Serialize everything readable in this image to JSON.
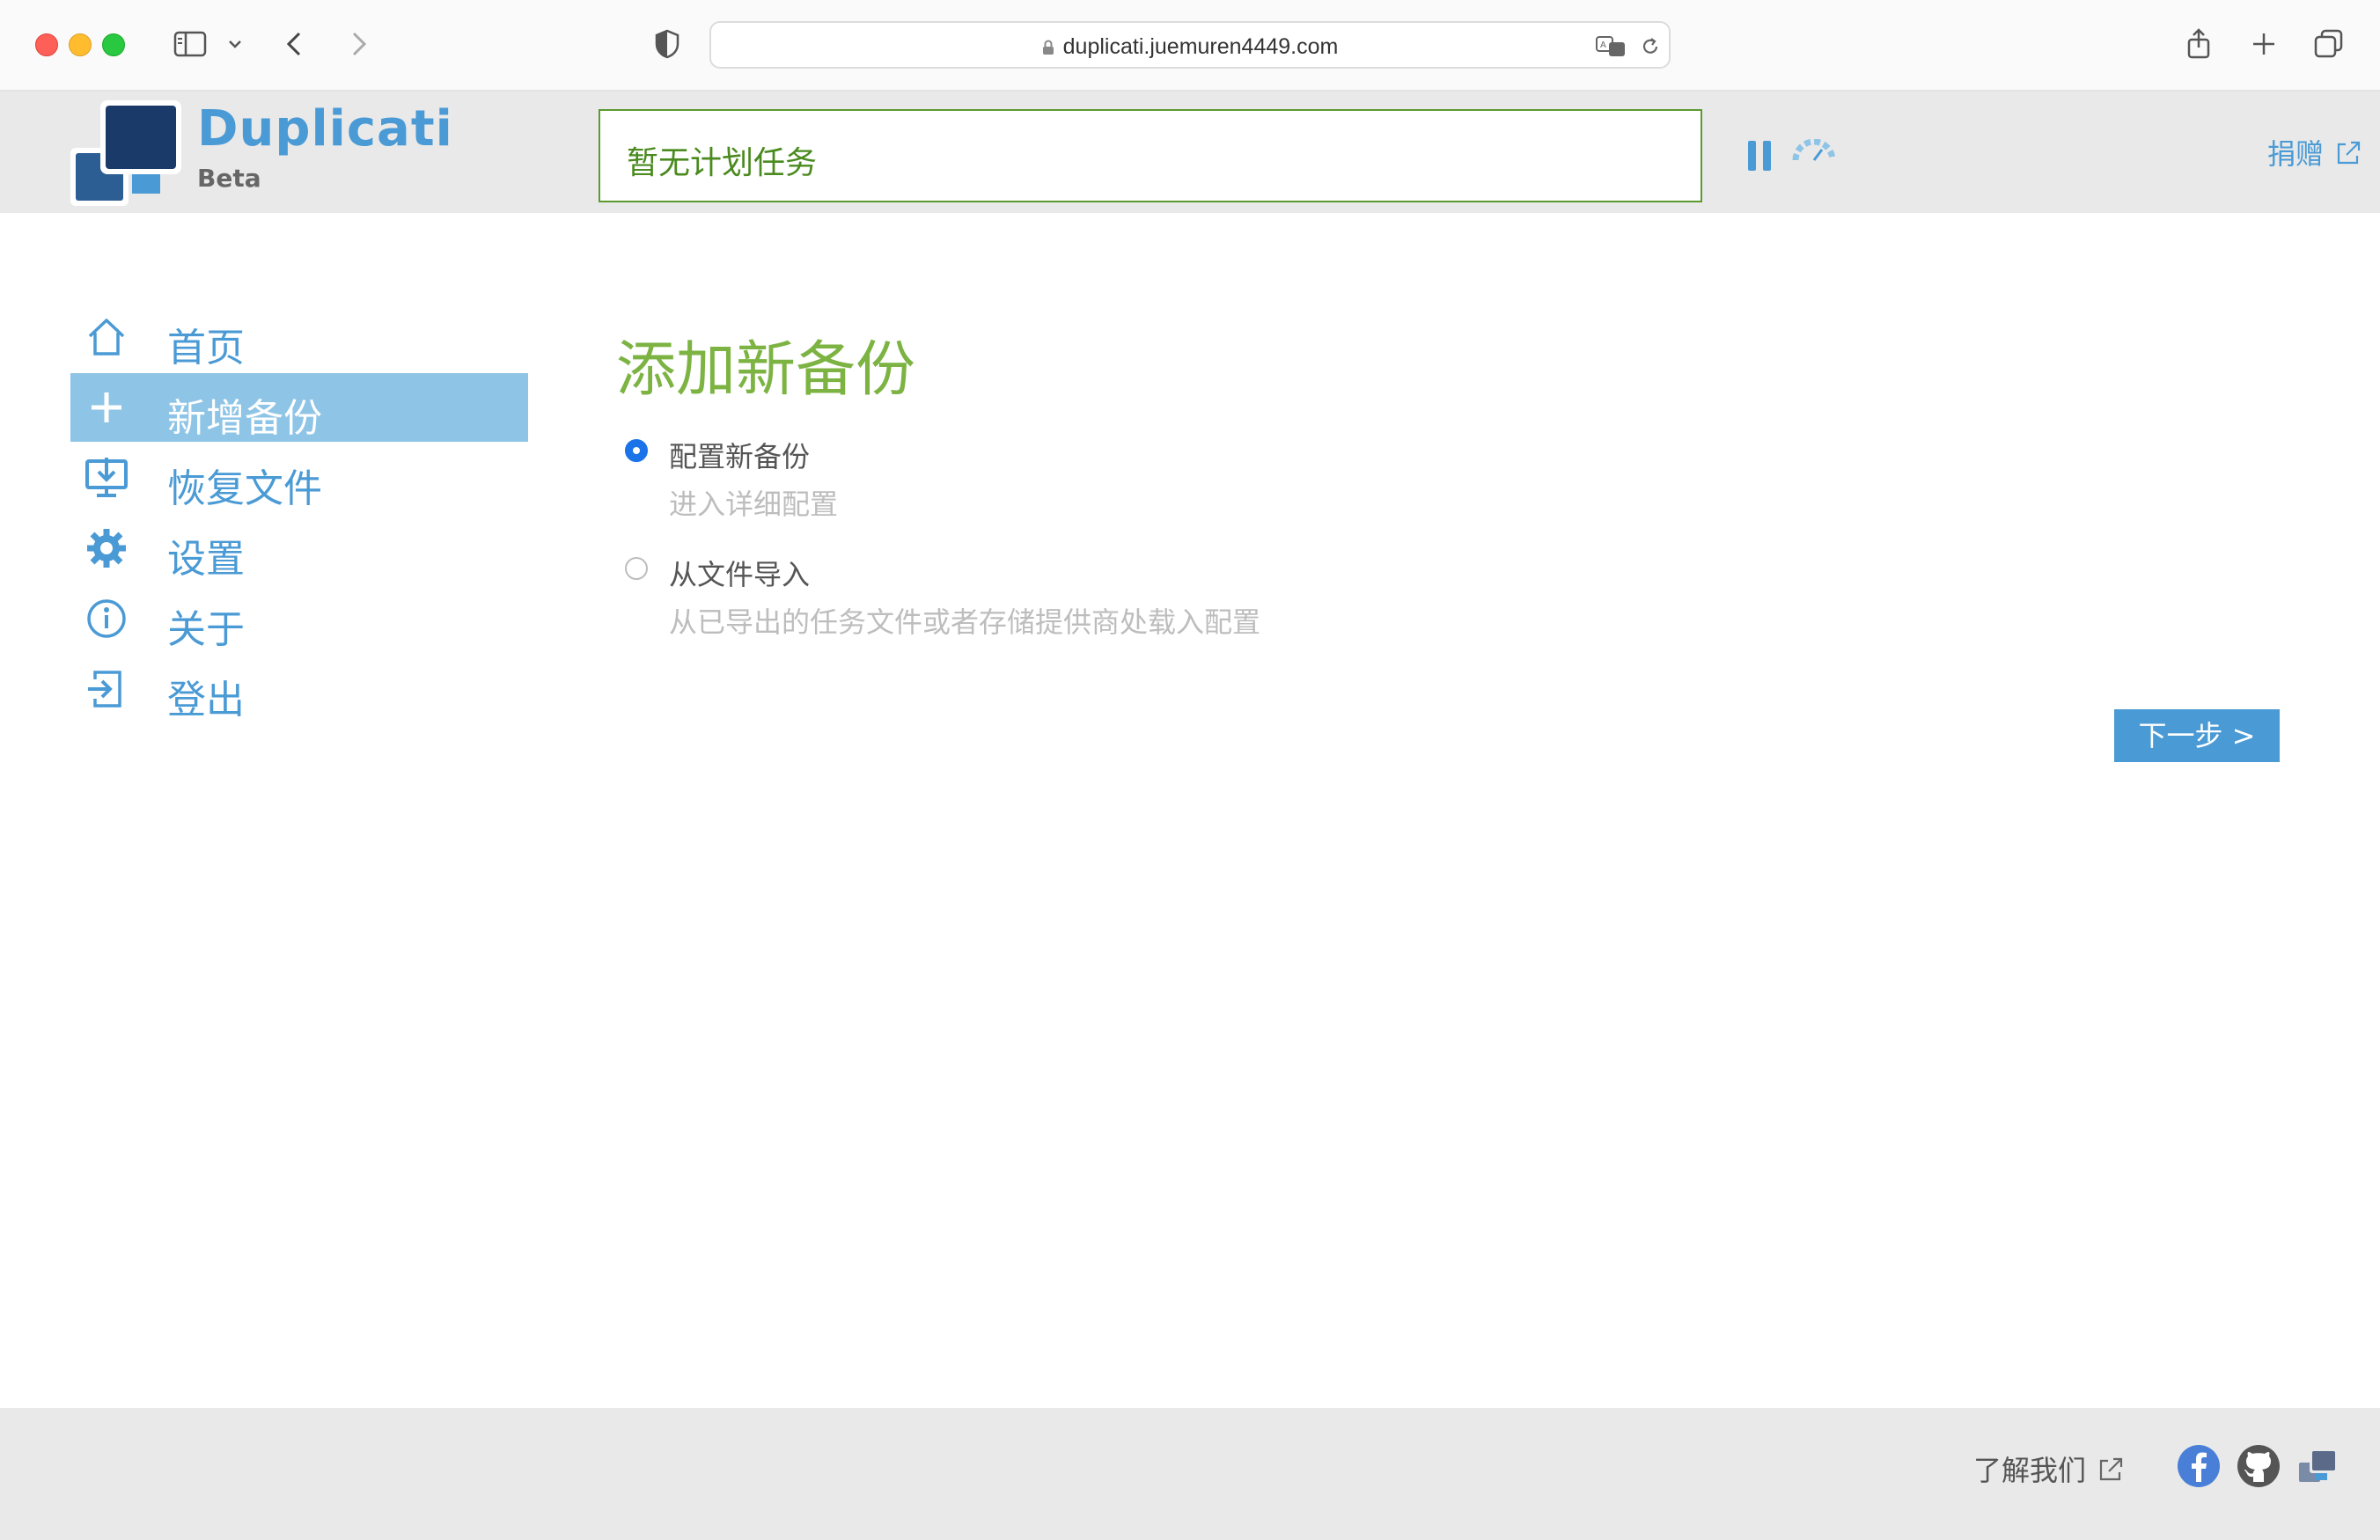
{
  "browser": {
    "url": "duplicati.juemuren4449.com"
  },
  "header": {
    "brand": "Duplicati",
    "edition": "Beta",
    "status": "暂无计划任务",
    "donate_label": "捐赠"
  },
  "sidebar": {
    "items": [
      {
        "label": "首页",
        "icon": "home-icon"
      },
      {
        "label": "新增备份",
        "icon": "plus-icon",
        "active": true
      },
      {
        "label": "恢复文件",
        "icon": "restore-icon"
      },
      {
        "label": "设置",
        "icon": "gear-icon"
      },
      {
        "label": "关于",
        "icon": "info-icon"
      },
      {
        "label": "登出",
        "icon": "logout-icon"
      }
    ]
  },
  "main": {
    "title": "添加新备份",
    "options": [
      {
        "label": "配置新备份",
        "description": "进入详细配置",
        "selected": true
      },
      {
        "label": "从文件导入",
        "description": "从已导出的任务文件或者存储提供商处载入配置",
        "selected": false
      }
    ],
    "next_label": "下一步 >"
  },
  "footer": {
    "about_label": "了解我们"
  },
  "colors": {
    "accent": "#4a9ad5",
    "active_nav": "#8ec4e6",
    "title_green": "#7cb342",
    "status_green": "#4a8a1e",
    "header_bg": "#e9e9e9"
  }
}
